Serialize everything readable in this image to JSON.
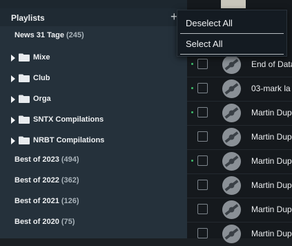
{
  "panel": {
    "title": "Playlists",
    "add_icon": "plus-icon",
    "items": [
      {
        "label": "News 31 Tage",
        "count": "(245)",
        "folder": false
      },
      {
        "label": "Mixe",
        "count": "",
        "folder": true
      },
      {
        "label": "Club",
        "count": "",
        "folder": true
      },
      {
        "label": "Orga",
        "count": "",
        "folder": true
      },
      {
        "label": "SNTX Compilations",
        "count": "",
        "folder": true
      },
      {
        "label": "NRBT Compilations",
        "count": "",
        "folder": true
      },
      {
        "label": "Best of 2023",
        "count": "(494)",
        "folder": false
      },
      {
        "label": "Best of 2022",
        "count": "(362)",
        "folder": false
      },
      {
        "label": "Best of 2021",
        "count": "(126)",
        "folder": false
      },
      {
        "label": "Best of 2020",
        "count": "(75)",
        "folder": false
      }
    ]
  },
  "menu": {
    "deselect_all": "Deselect All",
    "select_all": "Select All"
  },
  "tracks": [
    {
      "title": "End of Data",
      "active": true
    },
    {
      "title": "03-mark la",
      "active": true
    },
    {
      "title": "Martin Dup",
      "active": true
    },
    {
      "title": "Martin Dup",
      "active": false
    },
    {
      "title": "Martin Dup",
      "active": true
    },
    {
      "title": "Martin Dup",
      "active": false
    },
    {
      "title": "Martin Dup",
      "active": false
    },
    {
      "title": "Martin Dup",
      "active": false
    }
  ],
  "colors": {
    "panel_bg": "#25313b",
    "count_text": "#a9b3ba",
    "active_dot": "#3dbb6a",
    "menu_bg": "#141b22"
  }
}
